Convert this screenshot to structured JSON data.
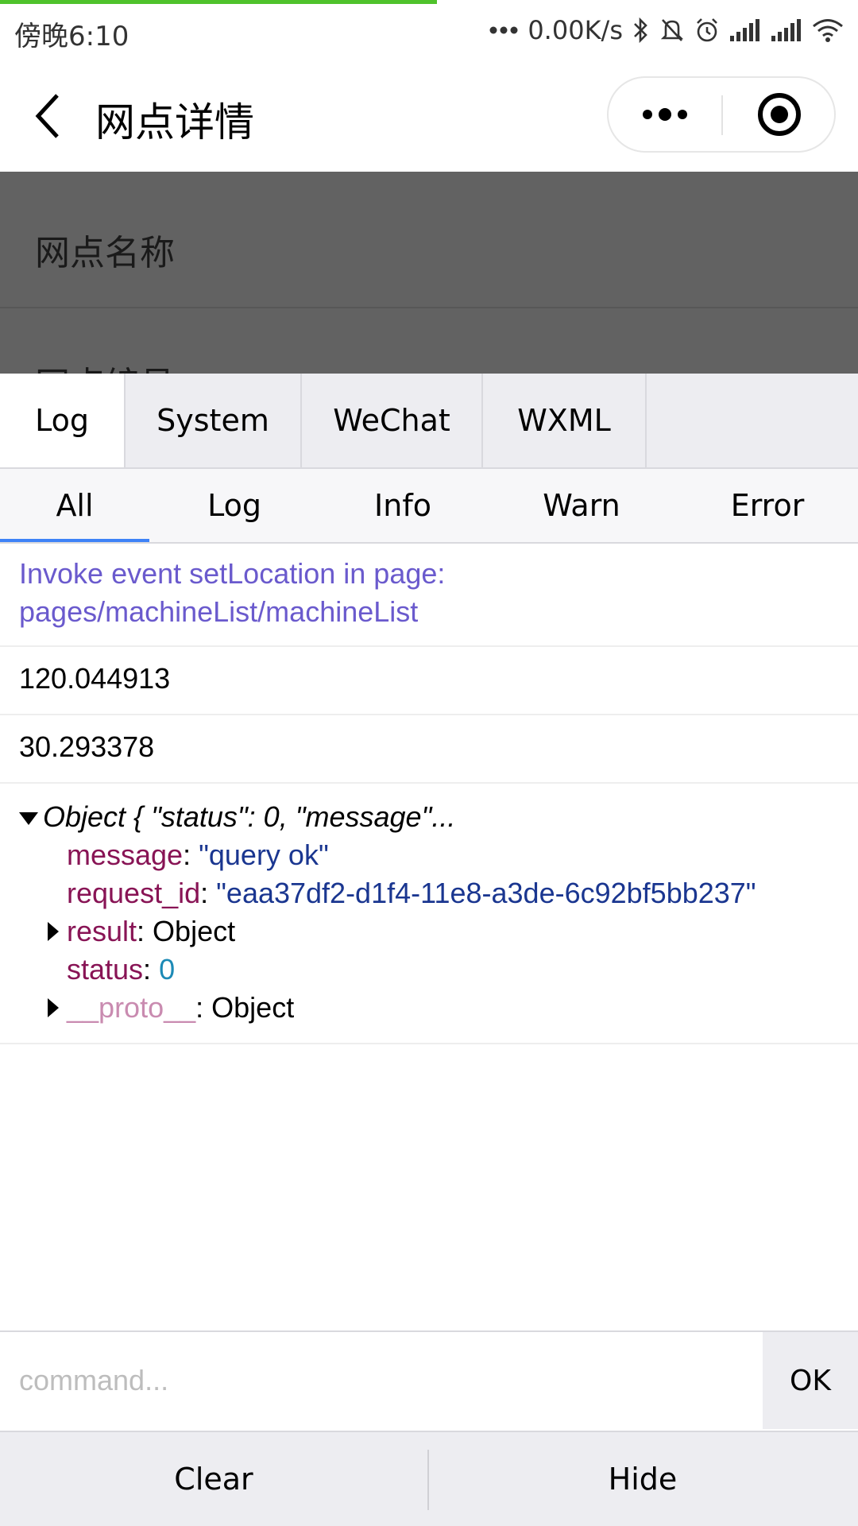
{
  "status_bar": {
    "time": "傍晚6:10",
    "net_speed": "0.00K/s"
  },
  "nav": {
    "title": "网点详情"
  },
  "page": {
    "field1_label": "网点名称",
    "field2_label": "网点编号"
  },
  "console": {
    "tabs": [
      "Log",
      "System",
      "WeChat",
      "WXML"
    ],
    "active_tab": "Log",
    "filters": [
      "All",
      "Log",
      "Info",
      "Warn",
      "Error"
    ],
    "active_filter": "All",
    "logs": {
      "info_line1": "Invoke event setLocation in page:",
      "info_line2": "pages/machineList/machineList",
      "value1": "120.044913",
      "value2": "30.293378",
      "object_head": "Object { \"status\": 0, \"message\"...",
      "message_key": "message",
      "message_val": "\"query ok\"",
      "request_id_key": "request_id",
      "request_id_val": "\"eaa37df2-d1f4-11e8-a3de-6c92bf5bb237\"",
      "result_key": "result",
      "result_val": "Object",
      "status_key": "status",
      "status_val": "0",
      "proto_key": "__proto__",
      "proto_val": "Object"
    },
    "command_placeholder": "command...",
    "ok_label": "OK",
    "clear_label": "Clear",
    "hide_label": "Hide"
  },
  "colors": {
    "progress": "#4fc22b",
    "active_underline": "#3e82f7",
    "info_text": "#6a5acd",
    "key": "#881455",
    "string": "#1a3690",
    "number": "#1c8ab6"
  }
}
